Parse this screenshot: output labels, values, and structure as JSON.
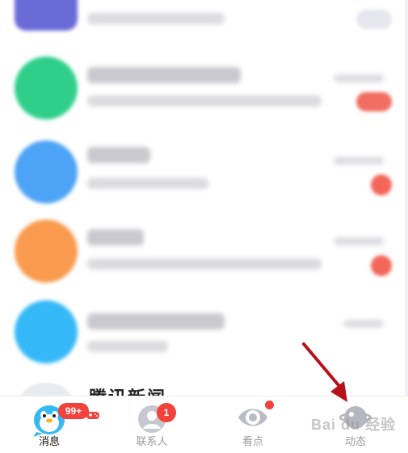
{
  "conversation_list": {
    "partial_title": "腾讯新闻"
  },
  "tabbar": {
    "tabs": [
      {
        "label": "消息",
        "badge": "99+",
        "active": true
      },
      {
        "label": "联系人",
        "badge": "1",
        "active": false
      },
      {
        "label": "看点",
        "badge": "",
        "active": false
      },
      {
        "label": "动态",
        "badge": "",
        "active": false
      }
    ]
  },
  "watermark": "Bai du 经验",
  "colors": {
    "badge_red": "#f3423c",
    "annotation_arrow": "#b5121b",
    "avatar_green": "#2fcf8a",
    "avatar_blue": "#4da3f5",
    "avatar_orange": "#f99a4e",
    "avatar_cyan": "#35b8f8",
    "avatar_purple": "#6b6bd8"
  }
}
